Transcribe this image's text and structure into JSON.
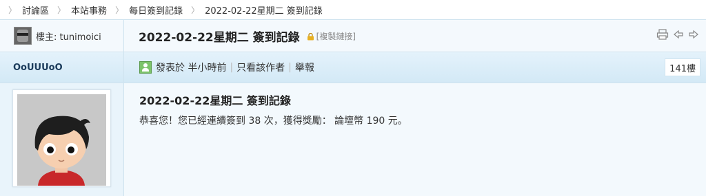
{
  "breadcrumb": [
    {
      "label": "討論區"
    },
    {
      "label": "本站事務"
    },
    {
      "label": "每日簽到記錄"
    },
    {
      "label": "2022-02-22星期二 簽到記錄"
    }
  ],
  "thread": {
    "author_label": "樓主: tunimoici",
    "title": "2022-02-22星期二 簽到記錄",
    "copy_link_label": "[複製鏈接]"
  },
  "tools": [
    {
      "icon": "print-icon"
    },
    {
      "icon": "prev-thread-icon"
    },
    {
      "icon": "next-thread-icon"
    }
  ],
  "post": {
    "poster_name": "OoUUUoO",
    "posted_label": "發表於 半小時前",
    "only_author_label": "只看該作者",
    "report_label": "舉報",
    "floor_label": "141樓",
    "content_title": "2022-02-22星期二 簽到記錄",
    "content_body": "恭喜您！您已經連續簽到 38 次，獲得獎勵： 論壇幣 190 元。"
  }
}
